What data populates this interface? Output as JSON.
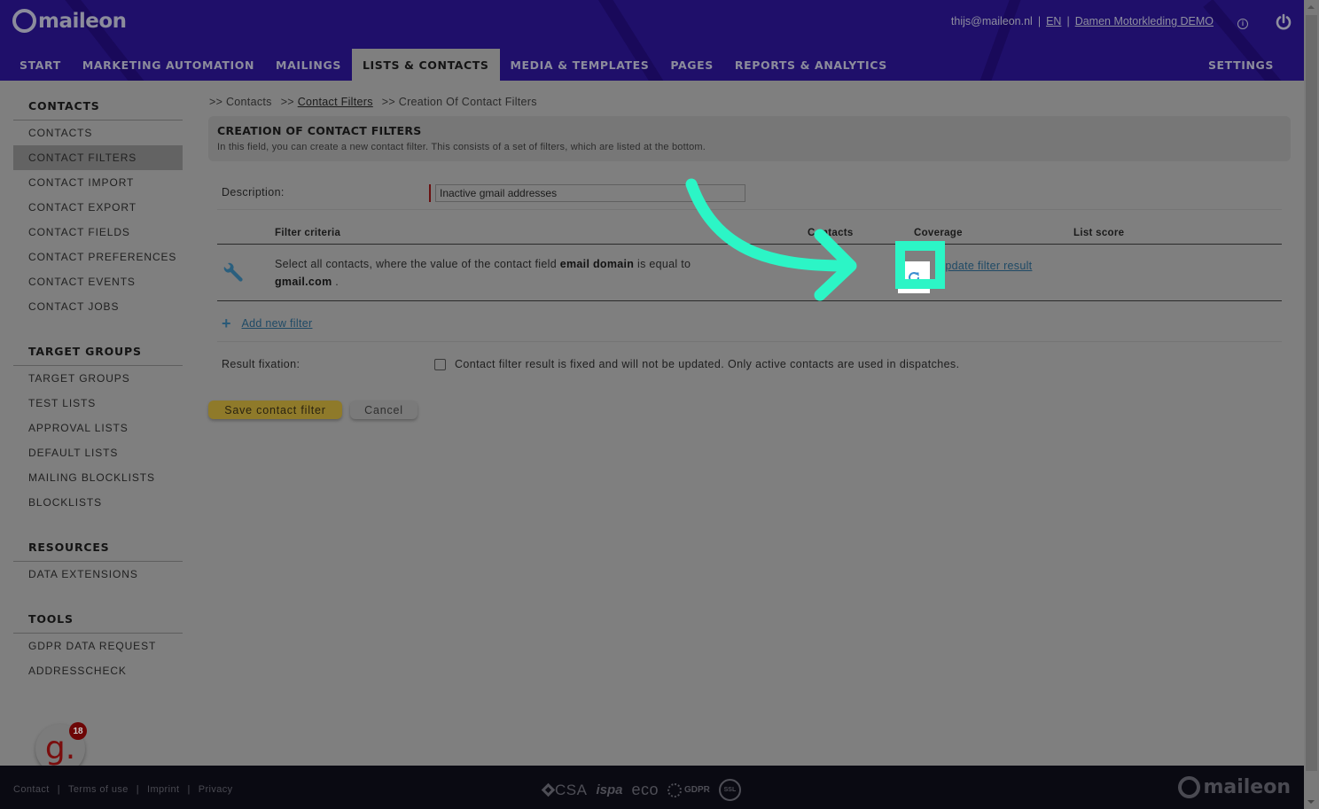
{
  "app": {
    "brand": "maileon",
    "colors": {
      "header_bg": "#1f0f6a",
      "accent_annotation": "#2cf5c6",
      "save_button": "#8f7a2a",
      "link": "#1f4a66",
      "badge": "#6d0606"
    }
  },
  "header": {
    "user_email": "thijs@maileon.nl",
    "separator": "|",
    "language": "EN",
    "account": "Damen Motorkleding DEMO",
    "info_icon": "info-icon",
    "power_icon": "power-icon"
  },
  "nav": {
    "tabs": [
      {
        "label": "START",
        "active": false
      },
      {
        "label": "MARKETING AUTOMATION",
        "active": false
      },
      {
        "label": "MAILINGS",
        "active": false
      },
      {
        "label": "LISTS & CONTACTS",
        "active": true
      },
      {
        "label": "MEDIA & TEMPLATES",
        "active": false
      },
      {
        "label": "PAGES",
        "active": false
      },
      {
        "label": "REPORTS & ANALYTICS",
        "active": false
      }
    ],
    "settings": "SETTINGS"
  },
  "sidebar": {
    "sections": [
      {
        "heading": "CONTACTS",
        "items": [
          "CONTACTS",
          "CONTACT FILTERS",
          "CONTACT IMPORT",
          "CONTACT EXPORT",
          "CONTACT FIELDS",
          "CONTACT PREFERENCES",
          "CONTACT EVENTS",
          "CONTACT JOBS"
        ]
      },
      {
        "heading": "TARGET GROUPS",
        "items": [
          "TARGET GROUPS",
          "TEST LISTS",
          "APPROVAL LISTS",
          "DEFAULT LISTS",
          "MAILING BLOCKLISTS",
          "BLOCKLISTS"
        ]
      },
      {
        "heading": "RESOURCES",
        "items": [
          "DATA EXTENSIONS"
        ]
      },
      {
        "heading": "TOOLS",
        "items": [
          "GDPR DATA REQUEST",
          "ADDRESSCHECK"
        ]
      }
    ],
    "active_item": "CONTACT FILTERS"
  },
  "breadcrumb": {
    "items": [
      {
        "label": ">> Contacts",
        "link": false
      },
      {
        "label": "Contact Filters",
        "prefix": ">>",
        "link": true
      },
      {
        "label": ">> Creation Of Contact Filters",
        "link": false
      }
    ]
  },
  "page": {
    "title": "CREATION OF CONTACT FILTERS",
    "intro": "In this field, you can create a new contact filter. This consists of a set of filters, which are listed at the bottom.",
    "description_label": "Description:",
    "description_value": "Inactive gmail addresses",
    "table": {
      "headers": {
        "criteria": "Filter criteria",
        "contacts": "Contacts",
        "coverage": "Coverage",
        "list_score": "List score"
      },
      "rows": [
        {
          "icon": "wrench-icon",
          "text_before": "Select all contacts, where the value of the contact field ",
          "field": "email domain",
          "text_middle": " is equal to",
          "value": "gmail.com",
          "text_after": " .",
          "update_link": "Update filter result"
        }
      ]
    },
    "add_filter": "Add new filter",
    "result_fixation_label": "Result fixation:",
    "result_fixation_text": "Contact filter result is fixed and will not be updated. Only active contacts are used in dispatches.",
    "result_fixation_checked": false,
    "save_button": "Save contact filter",
    "cancel_button": "Cancel"
  },
  "widget": {
    "letter": "g.",
    "badge_count": "18"
  },
  "footer": {
    "links": [
      "Contact",
      "Terms of use",
      "Imprint",
      "Privacy"
    ],
    "separator": "|",
    "certifications": [
      "CSA",
      "ispa",
      "eco",
      "GDPR",
      "SSL"
    ],
    "logo": "maileon"
  }
}
